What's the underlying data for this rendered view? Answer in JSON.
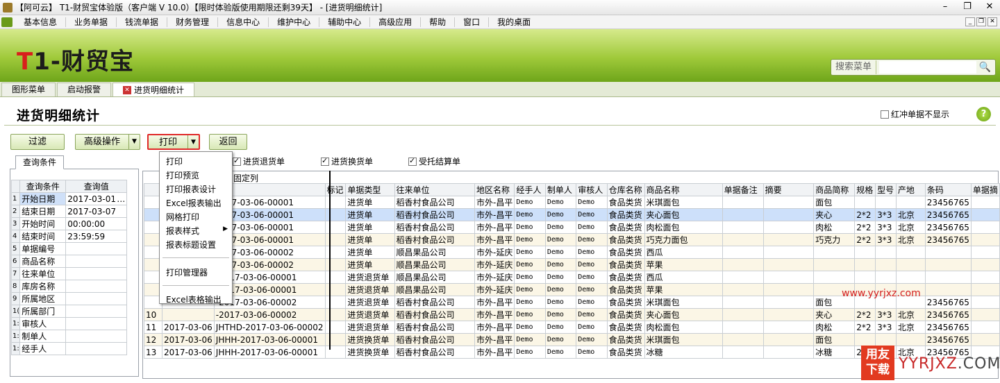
{
  "window": {
    "title": "【阿可云】 T1-财贸宝体验版（客户端 V 10.0）【限时体验版使用期限还剩39天】 - [进货明细统计]"
  },
  "menu": [
    "基本信息",
    "业务单据",
    "钱流单据",
    "财务管理",
    "信息中心",
    "维护中心",
    "辅助中心",
    "高级应用",
    "帮助",
    "窗口",
    "我的桌面"
  ],
  "banner": {
    "brand_t": "T",
    "brand_rest": "1-财贸宝",
    "search_label": "搜索菜单",
    "search_value": ""
  },
  "tabs": [
    "图形菜单",
    "启动报警",
    "进货明细统计"
  ],
  "page": {
    "title": "进货明细统计",
    "hide_red_label": "红冲单据不显示",
    "help": "?"
  },
  "toolbar": {
    "filter": "过滤",
    "advanced": "高级操作",
    "print": "打印",
    "back": "返回"
  },
  "checks": [
    {
      "label": "进货退货单",
      "checked": true
    },
    {
      "label": "进货换货单",
      "checked": true
    },
    {
      "label": "受托结算单",
      "checked": true
    }
  ],
  "query": {
    "tab": "查询条件",
    "header": [
      "查询条件",
      "查询值"
    ],
    "rows": [
      {
        "n": "1",
        "k": "开始日期",
        "v": "2017-03-01",
        "extra": "…"
      },
      {
        "n": "2",
        "k": "结束日期",
        "v": "2017-03-07",
        "extra": ""
      },
      {
        "n": "3",
        "k": "开始时间",
        "v": "00:00:00",
        "extra": ""
      },
      {
        "n": "4",
        "k": "结束时间",
        "v": "23:59:59",
        "extra": ""
      },
      {
        "n": "5",
        "k": "单据编号",
        "v": "",
        "extra": ""
      },
      {
        "n": "6",
        "k": "商品名称",
        "v": "",
        "extra": ""
      },
      {
        "n": "7",
        "k": "往来单位",
        "v": "",
        "extra": ""
      },
      {
        "n": "8",
        "k": "库房名称",
        "v": "",
        "extra": ""
      },
      {
        "n": "9",
        "k": "所属地区",
        "v": "",
        "extra": ""
      },
      {
        "n": "1(",
        "k": "所属部门",
        "v": "",
        "extra": ""
      },
      {
        "n": "1:",
        "k": "审核人",
        "v": "",
        "extra": ""
      },
      {
        "n": "1:",
        "k": "制单人",
        "v": "",
        "extra": ""
      },
      {
        "n": "1:",
        "k": "经手人",
        "v": "",
        "extra": ""
      }
    ]
  },
  "grid": {
    "fixed_col_label": "固定列",
    "columns": [
      "",
      "",
      "编号",
      "标记",
      "单据类型",
      "往来单位",
      "地区名称",
      "经手人",
      "制单人",
      "审核人",
      "仓库名称",
      "商品名称",
      "单据备注",
      "摘要",
      "商品简称",
      "规格",
      "型号",
      "产地",
      "条码",
      "单据摘"
    ],
    "rows": [
      [
        "",
        "",
        "2017-03-06-00001",
        "",
        "进货单",
        "稻香村食品公司",
        "市外-昌平",
        "Demo",
        "Demo",
        "Demo",
        "食品类货",
        "米琪面包",
        "",
        "",
        "面包",
        "",
        "",
        "",
        "23456765",
        ""
      ],
      [
        "",
        "",
        "2017-03-06-00001",
        "",
        "进货单",
        "稻香村食品公司",
        "市外-昌平",
        "Demo",
        "Demo",
        "Demo",
        "食品类货",
        "夹心面包",
        "",
        "",
        "夹心",
        "2*2",
        "3*3",
        "北京",
        "23456765",
        ""
      ],
      [
        "",
        "",
        "2017-03-06-00001",
        "",
        "进货单",
        "稻香村食品公司",
        "市外-昌平",
        "Demo",
        "Demo",
        "Demo",
        "食品类货",
        "肉松面包",
        "",
        "",
        "肉松",
        "2*2",
        "3*3",
        "北京",
        "23456765",
        ""
      ],
      [
        "",
        "",
        "2017-03-06-00001",
        "",
        "进货单",
        "稻香村食品公司",
        "市外-昌平",
        "Demo",
        "Demo",
        "Demo",
        "食品类货",
        "巧克力面包",
        "",
        "",
        "巧克力",
        "2*2",
        "3*3",
        "北京",
        "23456765",
        ""
      ],
      [
        "",
        "",
        "2017-03-06-00002",
        "",
        "进货单",
        "顺昌果品公司",
        "市外-延庆",
        "Demo",
        "Demo",
        "Demo",
        "食品类货",
        "西瓜",
        "",
        "",
        "",
        "",
        "",
        "",
        "",
        ""
      ],
      [
        "",
        "",
        "2017-03-06-00002",
        "",
        "进货单",
        "顺昌果品公司",
        "市外-延庆",
        "Demo",
        "Demo",
        "Demo",
        "食品类货",
        "苹果",
        "",
        "",
        "",
        "",
        "",
        "",
        "",
        ""
      ],
      [
        "",
        "",
        "-2017-03-06-00001",
        "",
        "进货退货单",
        "顺昌果品公司",
        "市外-延庆",
        "Demo",
        "Demo",
        "Demo",
        "食品类货",
        "西瓜",
        "",
        "",
        "",
        "",
        "",
        "",
        "",
        ""
      ],
      [
        "",
        "",
        "-2017-03-06-00001",
        "",
        "进货退货单",
        "顺昌果品公司",
        "市外-延庆",
        "Demo",
        "Demo",
        "Demo",
        "食品类货",
        "苹果",
        "",
        "",
        "",
        "",
        "",
        "",
        "",
        ""
      ],
      [
        "",
        "",
        "-2017-03-06-00002",
        "",
        "进货退货单",
        "稻香村食品公司",
        "市外-昌平",
        "Demo",
        "Demo",
        "Demo",
        "食品类货",
        "米琪面包",
        "",
        "",
        "面包",
        "",
        "",
        "",
        "23456765",
        ""
      ],
      [
        "10",
        "",
        "-2017-03-06-00002",
        "",
        "进货退货单",
        "稻香村食品公司",
        "市外-昌平",
        "Demo",
        "Demo",
        "Demo",
        "食品类货",
        "夹心面包",
        "",
        "",
        "夹心",
        "2*2",
        "3*3",
        "北京",
        "23456765",
        ""
      ],
      [
        "11",
        "2017-03-06",
        "JHTHD-2017-03-06-00002",
        "",
        "进货退货单",
        "稻香村食品公司",
        "市外-昌平",
        "Demo",
        "Demo",
        "Demo",
        "食品类货",
        "肉松面包",
        "",
        "",
        "肉松",
        "2*2",
        "3*3",
        "北京",
        "23456765",
        ""
      ],
      [
        "12",
        "2017-03-06",
        "JHHH-2017-03-06-00001",
        "",
        "进货换货单",
        "稻香村食品公司",
        "市外-昌平",
        "Demo",
        "Demo",
        "Demo",
        "食品类货",
        "米琪面包",
        "",
        "",
        "面包",
        "",
        "",
        "",
        "23456765",
        ""
      ],
      [
        "13",
        "2017-03-06",
        "JHHH-2017-03-06-00001",
        "",
        "进货换货单",
        "稻香村食品公司",
        "市外-昌平",
        "Demo",
        "Demo",
        "Demo",
        "食品类货",
        "冰糖",
        "",
        "",
        "冰糖",
        "2*2",
        "3*3",
        "北京",
        "23456765",
        ""
      ]
    ]
  },
  "print_menu": {
    "items": [
      "打印",
      "打印预览",
      "打印报表设计",
      "Excel报表输出",
      "网格打印",
      "报表样式",
      "报表标题设置",
      "打印管理器",
      "Excel表格输出"
    ]
  },
  "watermark": {
    "url": "www.yyrjxz.com",
    "badge_line1": "用友",
    "badge_line2": "下载",
    "site_a": "YYRJXZ",
    "site_b": ".COM"
  }
}
